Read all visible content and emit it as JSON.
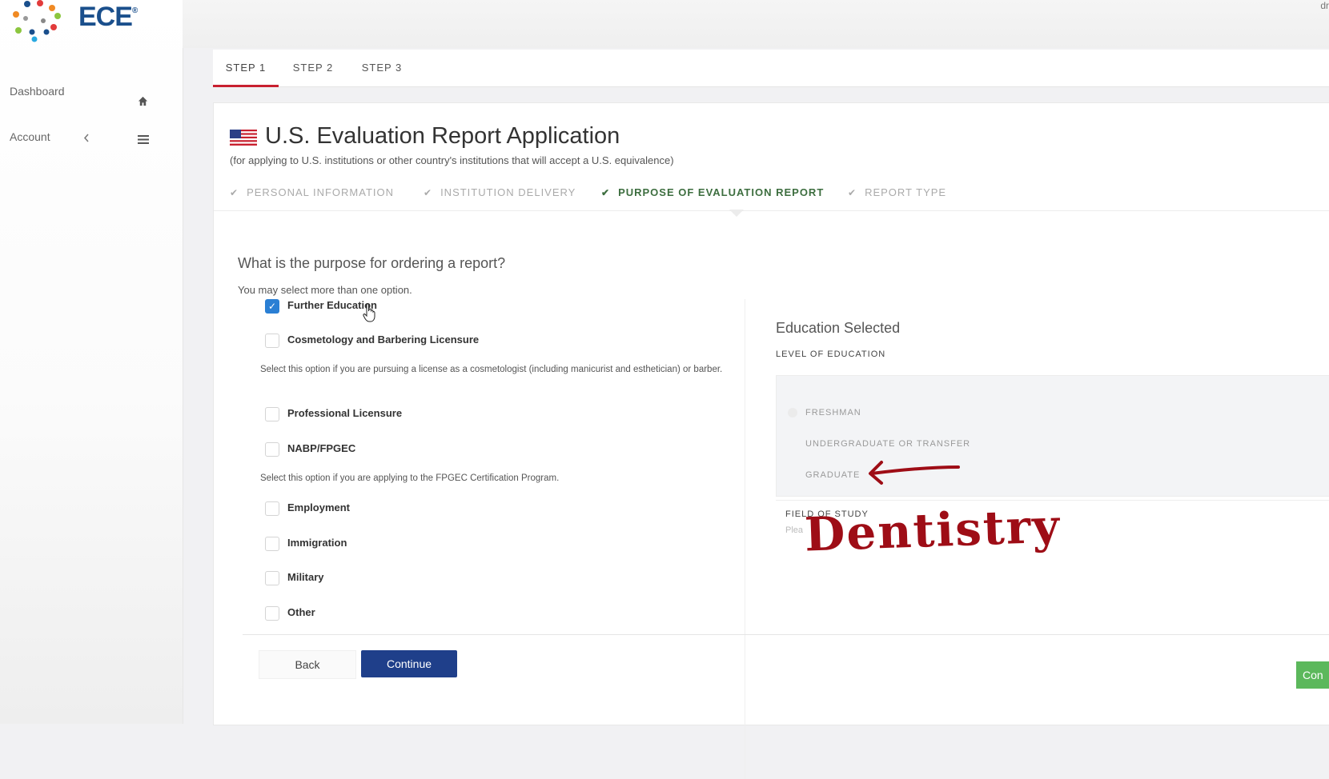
{
  "app": {
    "logo_text": "ECE"
  },
  "sidebar": {
    "items": [
      {
        "label": "Dashboard",
        "icon": "home-icon"
      },
      {
        "label": "Account",
        "icon": "menu-icon"
      }
    ]
  },
  "topbar": {
    "user_fragment": "dr"
  },
  "steps": [
    {
      "label": "STEP 1",
      "active": true
    },
    {
      "label": "STEP 2",
      "active": false
    },
    {
      "label": "STEP 3",
      "active": false
    }
  ],
  "form": {
    "title": "U.S. Evaluation Report Application",
    "subtitle": "(for applying to U.S. institutions or other country's institutions that will accept a U.S. equivalence)",
    "progress": [
      {
        "label": "PERSONAL INFORMATION",
        "state": "done"
      },
      {
        "label": "INSTITUTION DELIVERY",
        "state": "done"
      },
      {
        "label": "PURPOSE OF EVALUATION REPORT",
        "state": "current"
      },
      {
        "label": "REPORT TYPE",
        "state": "pending"
      }
    ],
    "question": "What is the purpose for ordering a report?",
    "hint": "You may select more than one option.",
    "options": [
      {
        "label": "Further Education",
        "checked": true
      },
      {
        "label": "Cosmetology and Barbering Licensure",
        "checked": false,
        "description": "Select this option if you are pursuing a license as a cosmetologist (including manicurist and esthetician) or barber."
      },
      {
        "label": "Professional Licensure",
        "checked": false
      },
      {
        "label": "NABP/FPGEC",
        "checked": false,
        "description": "Select this option if you are applying to the FPGEC Certification Program."
      },
      {
        "label": "Employment",
        "checked": false
      },
      {
        "label": "Immigration",
        "checked": false
      },
      {
        "label": "Military",
        "checked": false
      },
      {
        "label": "Other",
        "checked": false
      }
    ]
  },
  "education_panel": {
    "title": "Education Selected",
    "level_label": "LEVEL OF EDUCATION",
    "levels": [
      "FRESHMAN",
      "UNDERGRADUATE OR TRANSFER",
      "GRADUATE"
    ],
    "field_label": "FIELD OF STUDY",
    "field_placeholder": "Plea",
    "annotation": "Dentistry"
  },
  "buttons": {
    "back": "Back",
    "continue": "Continue",
    "continue_right": "Con"
  },
  "colors": {
    "accent_red": "#c8202f",
    "primary_blue": "#1f3f8a",
    "checkbox_blue": "#2a7fd4",
    "success_green": "#5cb85c",
    "current_step_green": "#3d6e3f",
    "annotation_red": "#9e0d16"
  }
}
